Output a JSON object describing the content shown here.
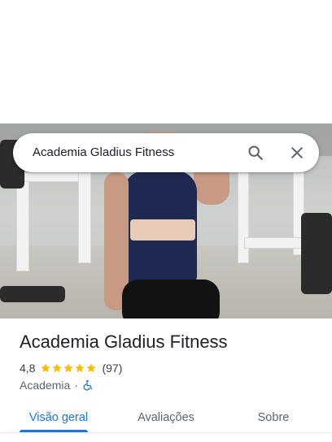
{
  "search": {
    "query": "Academia Gladius Fitness"
  },
  "place": {
    "name": "Academia Gladius Fitness",
    "rating": "4,8",
    "stars": 5,
    "review_count": "(97)",
    "category": "Academia",
    "separator": "·"
  },
  "tabs": [
    {
      "label": "Visão geral",
      "active": true
    },
    {
      "label": "Avaliações",
      "active": false
    },
    {
      "label": "Sobre",
      "active": false
    }
  ],
  "icons": {
    "search": "search-icon",
    "close": "close-icon",
    "accessible": "wheelchair-icon",
    "star": "star-icon"
  },
  "colors": {
    "accent": "#1a73e8",
    "star": "#fbbc04",
    "text": "#202124",
    "secondary": "#5f6368"
  }
}
